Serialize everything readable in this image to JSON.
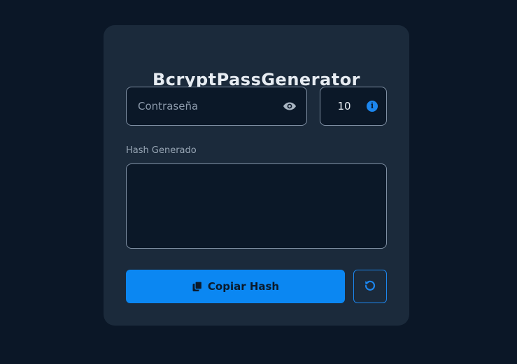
{
  "app": {
    "title": "BcryptPassGenerator"
  },
  "password": {
    "placeholder": "Contraseña",
    "value": "",
    "toggle_icon": "eye-icon"
  },
  "rounds": {
    "value": "10",
    "info_icon": "info-icon"
  },
  "hash": {
    "label": "Hash Generado",
    "value": ""
  },
  "actions": {
    "copy_label": "Copiar Hash",
    "copy_icon": "copy-icon",
    "reset_icon": "reset-icon"
  },
  "colors": {
    "page_bg": "#0b1727",
    "card_bg": "#1b2a3b",
    "field_bg": "#0b1828",
    "accent": "#0b87f2",
    "border": "#7f8fa3"
  }
}
